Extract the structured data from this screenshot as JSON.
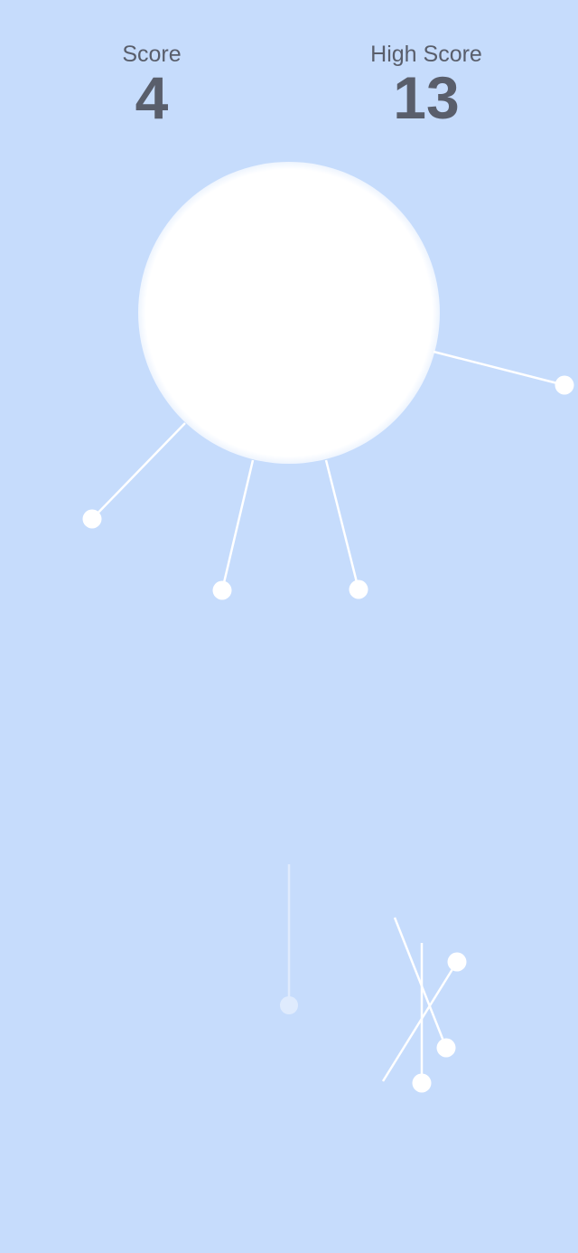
{
  "score": {
    "label": "Score",
    "value": "4"
  },
  "high_score": {
    "label": "High Score",
    "value": "13"
  },
  "colors": {
    "background": "#c6dcfc",
    "foreground": "#ffffff",
    "text": "#595e6b"
  }
}
